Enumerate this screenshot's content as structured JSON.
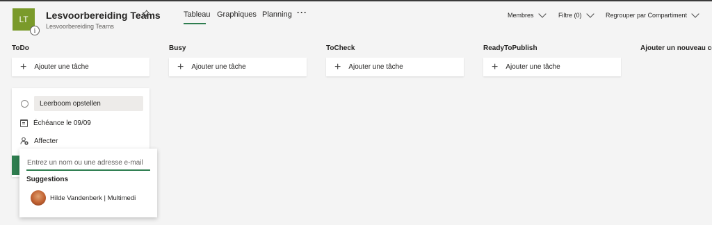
{
  "header": {
    "avatar_initials": "LT",
    "info_badge": "i",
    "plan_title": "Lesvoorbereiding Teams",
    "plan_subtitle": "Lesvoorbereiding Teams",
    "pin_icon": "pin-icon",
    "tabs": [
      {
        "label": "Tableau",
        "active": true
      },
      {
        "label": "Graphiques",
        "active": false
      },
      {
        "label": "Planning",
        "active": false
      }
    ],
    "more_label": "···",
    "controls": {
      "members": "Membres",
      "filter": "Filtre (0)",
      "group_by": "Regrouper par Compartiment"
    }
  },
  "buckets": [
    {
      "title": "ToDo",
      "add_task_label": "Ajouter une tâche"
    },
    {
      "title": "Busy",
      "add_task_label": "Ajouter une tâche"
    },
    {
      "title": "ToCheck",
      "add_task_label": "Ajouter une tâche"
    },
    {
      "title": "ReadyToPublish",
      "add_task_label": "Ajouter une tâche"
    }
  ],
  "add_bucket_label": "Ajouter un nouveau con",
  "new_task": {
    "name_value": "Leerboom opstellen",
    "due_label": "Échéance le 09/09",
    "assign_label": "Affecter"
  },
  "assign_popup": {
    "placeholder": "Entrez un nom ou une adresse e-mail",
    "suggestions_title": "Suggestions",
    "suggestions": [
      {
        "name": "Hilde Vandenberk | Multimedi"
      }
    ]
  },
  "colors": {
    "accent": "#2e7d4f",
    "avatar_tile": "#7a9a2a",
    "background": "#f4f4f4"
  }
}
